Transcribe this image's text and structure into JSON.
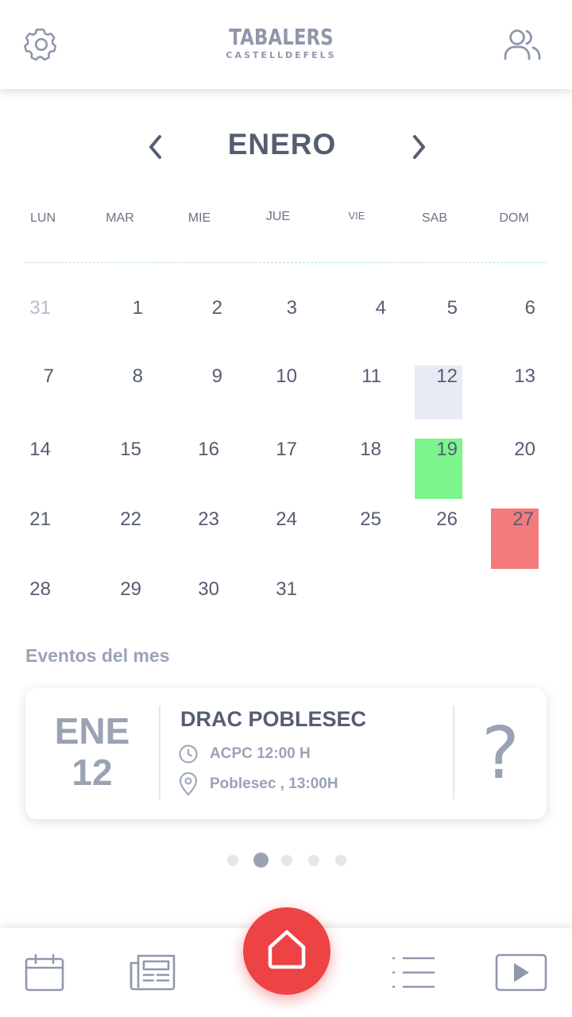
{
  "header": {
    "logo_main": "TABALERS",
    "logo_sub": "CASTELLDEFELS",
    "settings_icon": "gear-icon",
    "users_icon": "users-icon"
  },
  "calendar": {
    "month": "ENERO",
    "weekdays": [
      "LUN",
      "MAR",
      "MIE",
      "JUE",
      "VIE",
      "SAB",
      "DOM"
    ],
    "weeks": [
      [
        "31",
        "1",
        "2",
        "3",
        "4",
        "5",
        "6"
      ],
      [
        "7",
        "8",
        "9",
        "10",
        "11",
        "12",
        "13"
      ],
      [
        "14",
        "15",
        "16",
        "17",
        "18",
        "19",
        "20"
      ],
      [
        "21",
        "22",
        "23",
        "24",
        "25",
        "26",
        "27"
      ],
      [
        "28",
        "29",
        "30",
        "31"
      ]
    ],
    "highlight_colors": {
      "grey": "#e7ebf5",
      "green": "#7df58d",
      "red": "#f37b7b"
    }
  },
  "events": {
    "section_title": "Eventos del mes",
    "card": {
      "month": "ENE",
      "day": "12",
      "title": "DRAC POBLESEC",
      "time_text": "ACPC 12:00 H",
      "place_text": "Poblesec , 13:00H",
      "status": "?"
    },
    "pagination": {
      "count": 5,
      "active_index": 1
    }
  },
  "tabbar": {
    "items": [
      "calendar-icon",
      "news-icon",
      "home-icon",
      "list-icon",
      "play-icon"
    ],
    "accent": "#ee4345"
  }
}
